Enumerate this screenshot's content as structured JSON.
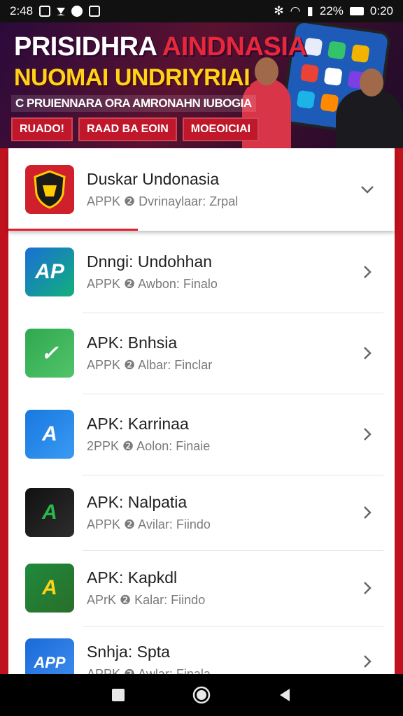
{
  "status_bar": {
    "time": "2:48",
    "battery": "22%",
    "clock_right": "0:20"
  },
  "banner": {
    "line1_white": "PRISIDHRA ",
    "line1_red": "AINDNASIA",
    "line2": "NUOMAI UNDRIYRIAI",
    "line3": "C PRUIENNARA ORA AMRONAHN IUBOGIA",
    "tags": [
      "RUADO!",
      "RAAD BA EOIN",
      "MOEOICIAI"
    ]
  },
  "apps": [
    {
      "title": "Duskar Undonasia",
      "subtitle": "APPK ❷ Dvrinaylaar: Zrpal",
      "icon_text": "",
      "icon_name": "shield-icon",
      "colors": [
        "#d0202c",
        "#ffcc00"
      ],
      "expanded": true
    },
    {
      "title": "Dnngi: Undohhan",
      "subtitle": "APPK ❷ Awbon: Finalo",
      "icon_text": "AP",
      "icon_name": "app-icon-blue-ap",
      "colors": [
        "#1a6fd6",
        "#12b07a"
      ],
      "expanded": false
    },
    {
      "title": "APK: Bnhsia",
      "subtitle": "APPK ❷ Albar: Finclar",
      "icon_text": "✓",
      "icon_name": "app-icon-green-check",
      "colors": [
        "#2fa84f",
        "#52c46a"
      ],
      "expanded": false
    },
    {
      "title": "APK: Karrinaa",
      "subtitle": "2PPK ❷ Aolon: Finaie",
      "icon_text": "A",
      "icon_name": "app-icon-blue-a",
      "colors": [
        "#1878e0",
        "#3a9af2"
      ],
      "expanded": false
    },
    {
      "title": "APK: Nalpatia",
      "subtitle": "APPK ❷ Avilar: Fiindo",
      "icon_text": "A",
      "icon_name": "app-icon-black-a",
      "colors": [
        "#111111",
        "#2d2d2d"
      ],
      "expanded": false
    },
    {
      "title": "APK: Kapkdl",
      "subtitle": "APrK ❷ Kalar: Fiindo",
      "icon_text": "A",
      "icon_name": "app-icon-green-a",
      "colors": [
        "#1e8a3c",
        "#2a6e2a"
      ],
      "expanded": false
    },
    {
      "title": "Snhja: Spta",
      "subtitle": "APPK ❷ Awlar: Finala",
      "icon_text": "APP",
      "icon_name": "app-icon-blue-app",
      "colors": [
        "#1a6ad8",
        "#3f8ef0"
      ],
      "expanded": false
    }
  ],
  "colors": {
    "accent_red": "#c0121e",
    "progress_red": "#e2202c"
  }
}
